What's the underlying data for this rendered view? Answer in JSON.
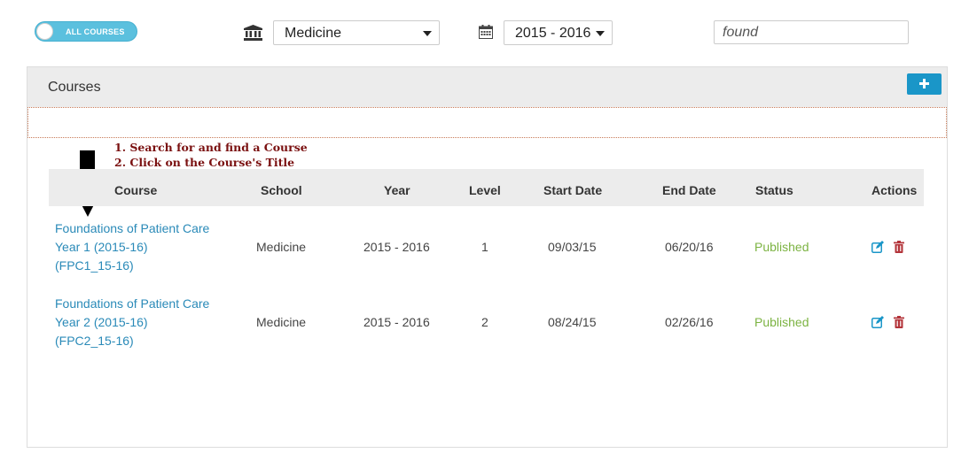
{
  "filters": {
    "toggle_label": "ALL COURSES",
    "school": "Medicine",
    "year": "2015 - 2016",
    "search_value": "found"
  },
  "panel": {
    "title": "Courses"
  },
  "instructions": {
    "line1": "1. Search for and find a Course",
    "line2": "2. Click on the Course's Title"
  },
  "table": {
    "columns": [
      "Course",
      "School",
      "Year",
      "Level",
      "Start Date",
      "End Date",
      "Status",
      "Actions"
    ],
    "rows": [
      {
        "course_line1": "Foundations of Patient Care",
        "course_line2": "Year 1 (2015-16)",
        "course_line3": "(FPC1_15-16)",
        "school": "Medicine",
        "year": "2015 - 2016",
        "level": "1",
        "start": "09/03/15",
        "end": "06/20/16",
        "status": "Published"
      },
      {
        "course_line1": "Foundations of Patient Care",
        "course_line2": "Year 2 (2015-16)",
        "course_line3": "(FPC2_15-16)",
        "school": "Medicine",
        "year": "2015 - 2016",
        "level": "2",
        "start": "08/24/15",
        "end": "02/26/16",
        "status": "Published"
      }
    ]
  },
  "colors": {
    "accent": "#1a96c8",
    "link": "#2a8ab8",
    "published": "#7cb342",
    "delete": "#b3343a",
    "instruction": "#7a1010"
  },
  "icons": [
    "bank-icon",
    "calendar-icon",
    "plus-icon",
    "edit-icon",
    "trash-icon",
    "down-arrow-icon"
  ]
}
